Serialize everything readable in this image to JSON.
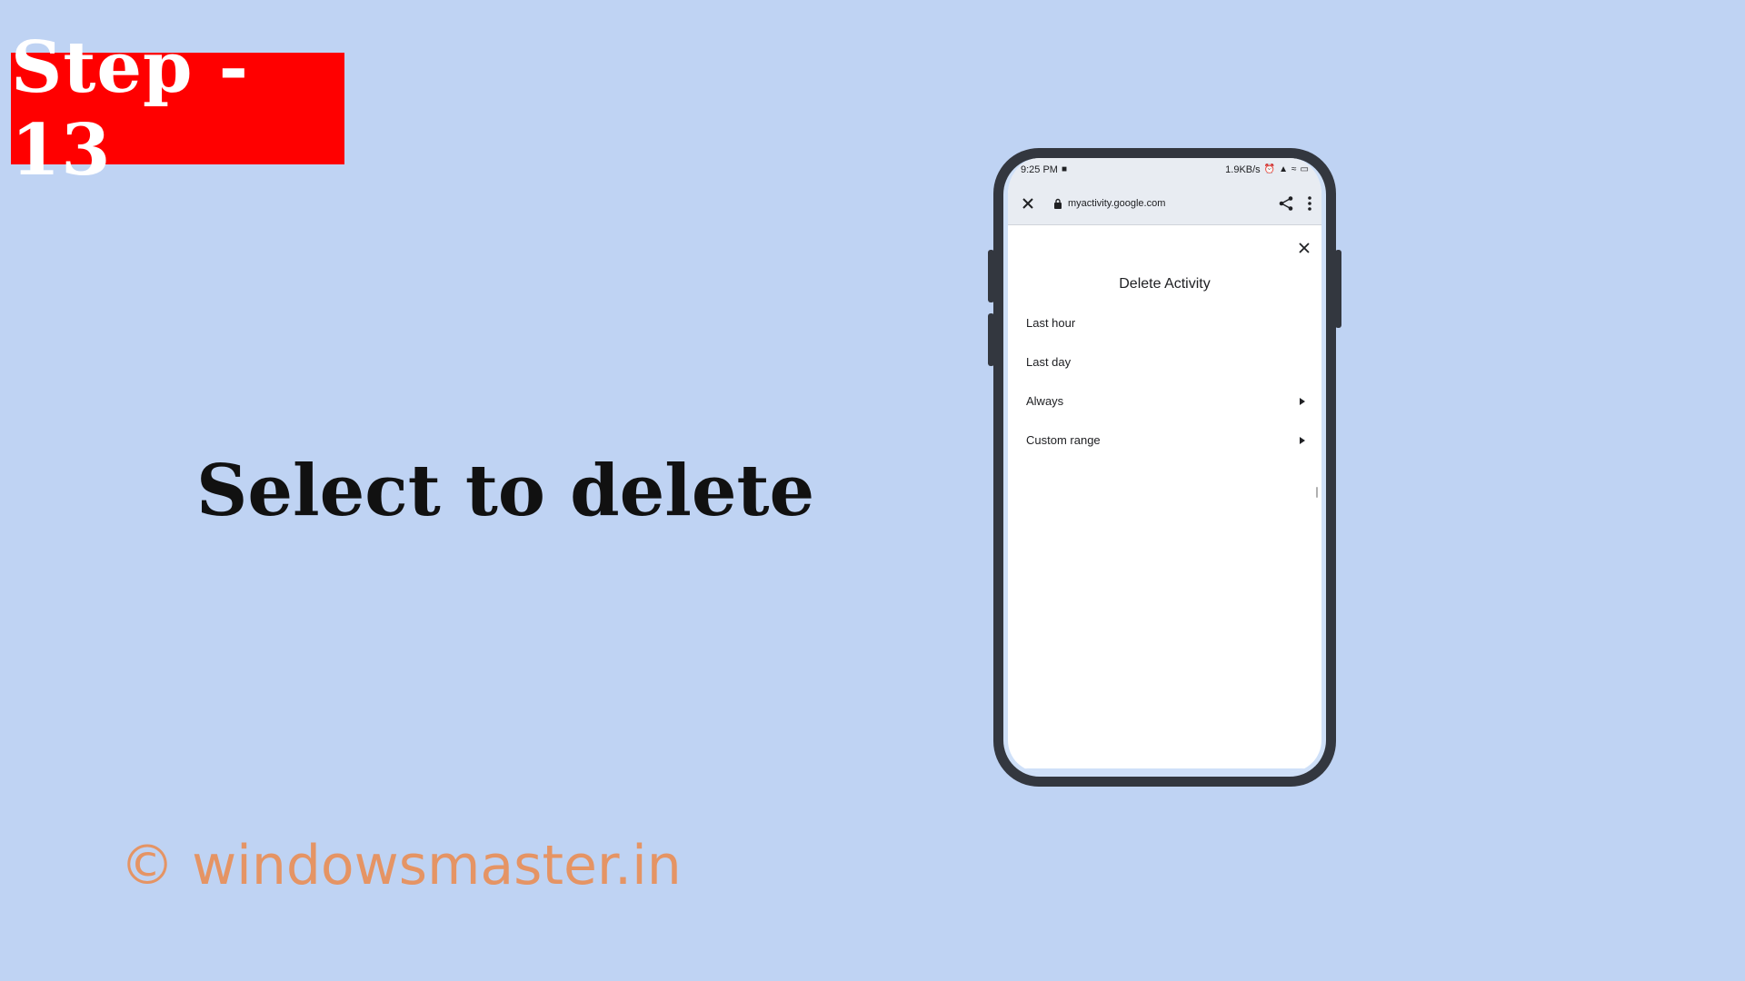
{
  "step_badge": "Step - 13",
  "headline": "Select to delete",
  "watermark": "© windowsmaster.in",
  "phone": {
    "status_bar": {
      "time": "9:25 PM",
      "speed": "1.9KB/s"
    },
    "browser": {
      "url": "myactivity.google.com"
    },
    "dialog": {
      "title": "Delete Activity",
      "items": [
        {
          "label": "Last hour",
          "has_submenu": false
        },
        {
          "label": "Last day",
          "has_submenu": false
        },
        {
          "label": "Always",
          "has_submenu": true
        },
        {
          "label": "Custom range",
          "has_submenu": true
        }
      ]
    }
  },
  "colors": {
    "background": "#bfd3f3",
    "badge": "#ff0000",
    "watermark": "#e59464",
    "phone_frame": "#33373f"
  }
}
